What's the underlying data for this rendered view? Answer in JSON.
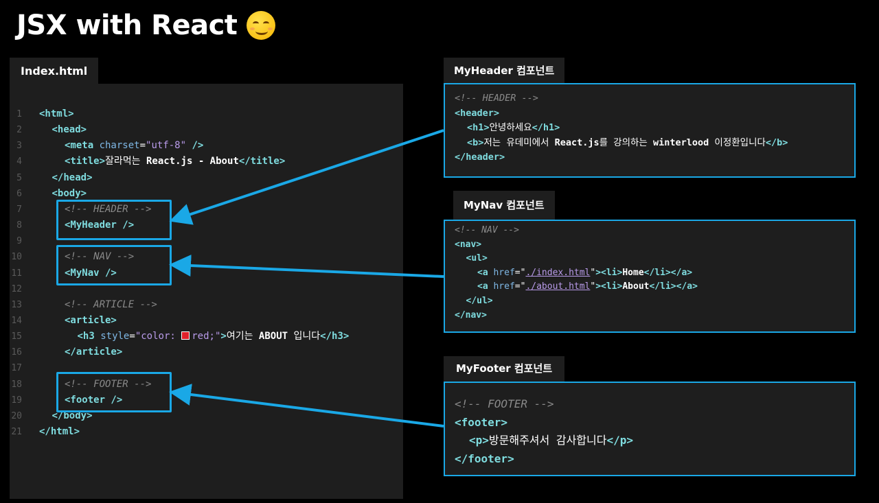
{
  "page": {
    "title": "JSX with React"
  },
  "editor": {
    "tab_label": "Index.html",
    "lines": [
      {
        "n": "1",
        "indent": 0,
        "tokens": [
          [
            "tg",
            "<html>"
          ]
        ]
      },
      {
        "n": "2",
        "indent": 1,
        "tokens": [
          [
            "tg",
            "<head>"
          ]
        ]
      },
      {
        "n": "3",
        "indent": 2,
        "tokens": [
          [
            "tg",
            "<meta "
          ],
          [
            "at",
            "charset"
          ],
          [
            "tx",
            "="
          ],
          [
            "st",
            "\"utf-8\""
          ],
          [
            "tg",
            " />"
          ]
        ]
      },
      {
        "n": "4",
        "indent": 2,
        "tokens": [
          [
            "tg",
            "<title>"
          ],
          [
            "tx",
            "잘라먹는 "
          ],
          [
            "bold",
            "React.js - About"
          ],
          [
            "tg",
            "</title>"
          ]
        ]
      },
      {
        "n": "5",
        "indent": 1,
        "tokens": [
          [
            "tg",
            "</head>"
          ]
        ]
      },
      {
        "n": "6",
        "indent": 1,
        "tokens": [
          [
            "tg",
            "<body>"
          ]
        ]
      },
      {
        "n": "7",
        "indent": 2,
        "tokens": [
          [
            "cm",
            "<!-- HEADER -->"
          ]
        ]
      },
      {
        "n": "8",
        "indent": 2,
        "tokens": [
          [
            "tg",
            "<MyHeader />"
          ]
        ]
      },
      {
        "n": "9",
        "indent": 0,
        "tokens": []
      },
      {
        "n": "10",
        "indent": 2,
        "tokens": [
          [
            "cm",
            "<!-- NAV -->"
          ]
        ]
      },
      {
        "n": "11",
        "indent": 2,
        "tokens": [
          [
            "tg",
            "<MyNav />"
          ]
        ]
      },
      {
        "n": "12",
        "indent": 0,
        "tokens": []
      },
      {
        "n": "13",
        "indent": 2,
        "tokens": [
          [
            "cm",
            "<!-- ARTICLE -->"
          ]
        ]
      },
      {
        "n": "14",
        "indent": 2,
        "tokens": [
          [
            "tg",
            "<article>"
          ]
        ]
      },
      {
        "n": "15",
        "indent": 3,
        "tokens": [
          [
            "tg",
            "<h3 "
          ],
          [
            "at",
            "style"
          ],
          [
            "tx",
            "="
          ],
          [
            "st",
            "\"color: "
          ],
          [
            "swatch",
            ""
          ],
          [
            "st",
            "red;\""
          ],
          [
            "tg",
            ">"
          ],
          [
            "tx",
            "여기는 "
          ],
          [
            "bold",
            "ABOUT"
          ],
          [
            "tx",
            " 입니다"
          ],
          [
            "tg",
            "</h3>"
          ]
        ]
      },
      {
        "n": "16",
        "indent": 2,
        "tokens": [
          [
            "tg",
            "</article>"
          ]
        ]
      },
      {
        "n": "17",
        "indent": 0,
        "tokens": []
      },
      {
        "n": "18",
        "indent": 2,
        "tokens": [
          [
            "cm",
            "<!-- FOOTER -->"
          ]
        ]
      },
      {
        "n": "19",
        "indent": 2,
        "tokens": [
          [
            "tg",
            "<footer />"
          ]
        ]
      },
      {
        "n": "20",
        "indent": 1,
        "tokens": [
          [
            "tg",
            "</body>"
          ]
        ]
      },
      {
        "n": "21",
        "indent": 0,
        "tokens": [
          [
            "tg",
            "</html>"
          ]
        ]
      }
    ]
  },
  "panels": [
    {
      "key": "header",
      "tab_label": "MyHeader 컴포넌트",
      "lines": [
        {
          "indent": 0,
          "tokens": [
            [
              "cm",
              "<!-- HEADER -->"
            ]
          ]
        },
        {
          "indent": 0,
          "tokens": [
            [
              "tg",
              "<header>"
            ]
          ]
        },
        {
          "indent": 1,
          "tokens": [
            [
              "tg",
              "<h1>"
            ],
            [
              "tx",
              "안녕하세요"
            ],
            [
              "tg",
              "</h1>"
            ]
          ]
        },
        {
          "indent": 1,
          "tokens": [
            [
              "tg",
              "<b>"
            ],
            [
              "tx",
              "저는 유데미에서 "
            ],
            [
              "bold",
              "React.js"
            ],
            [
              "tx",
              "를 강의하는 "
            ],
            [
              "bold",
              "winterlood"
            ],
            [
              "tx",
              " 이정환입니다"
            ],
            [
              "tg",
              "</b>"
            ]
          ]
        },
        {
          "indent": 0,
          "tokens": [
            [
              "tg",
              "</header>"
            ]
          ]
        }
      ]
    },
    {
      "key": "nav",
      "tab_label": "MyNav 컴포넌트",
      "lines": [
        {
          "indent": 0,
          "tokens": [
            [
              "cm",
              "<!-- NAV -->"
            ]
          ]
        },
        {
          "indent": 0,
          "tokens": [
            [
              "tg",
              "<nav>"
            ]
          ]
        },
        {
          "indent": 1,
          "tokens": [
            [
              "tg",
              "<ul>"
            ]
          ]
        },
        {
          "indent": 2,
          "tokens": [
            [
              "tg",
              "<a "
            ],
            [
              "at",
              "href"
            ],
            [
              "tx",
              "=\""
            ],
            [
              "url",
              "./index.html"
            ],
            [
              "tx",
              "\""
            ],
            [
              "tg",
              ">"
            ],
            [
              "tg",
              "<li>"
            ],
            [
              "bold",
              "Home"
            ],
            [
              "tg",
              "</li>"
            ],
            [
              "tg",
              "</a>"
            ]
          ]
        },
        {
          "indent": 2,
          "tokens": [
            [
              "tg",
              "<a "
            ],
            [
              "at",
              "href"
            ],
            [
              "tx",
              "=\""
            ],
            [
              "url",
              "./about.html"
            ],
            [
              "tx",
              "\""
            ],
            [
              "tg",
              ">"
            ],
            [
              "tg",
              "<li>"
            ],
            [
              "bold",
              "About"
            ],
            [
              "tg",
              "</li>"
            ],
            [
              "tg",
              "</a>"
            ]
          ]
        },
        {
          "indent": 1,
          "tokens": [
            [
              "tg",
              "</ul>"
            ]
          ]
        },
        {
          "indent": 0,
          "tokens": [
            [
              "tg",
              "</nav>"
            ]
          ]
        }
      ]
    },
    {
      "key": "footer",
      "tab_label": "MyFooter 컴포넌트",
      "lines": [
        {
          "indent": 0,
          "tokens": [
            [
              "cm",
              "<!-- FOOTER -->"
            ]
          ]
        },
        {
          "indent": 0,
          "tokens": [
            [
              "tg",
              "<footer>"
            ]
          ]
        },
        {
          "indent": 1,
          "tokens": [
            [
              "tg",
              "<p>"
            ],
            [
              "tx",
              "방문해주셔서 감사합니다"
            ],
            [
              "tg",
              "</p>"
            ]
          ]
        },
        {
          "indent": 0,
          "tokens": [
            [
              "tg",
              "</footer>"
            ]
          ]
        }
      ]
    }
  ],
  "colors": {
    "accent": "#1aa8e6",
    "background": "#000000",
    "editor_bg": "#1e1e1e"
  },
  "icons": {
    "title_emoji": "smirking-face-icon"
  }
}
